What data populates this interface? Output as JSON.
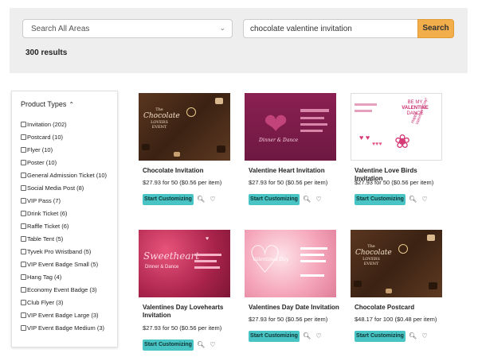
{
  "search": {
    "area_placeholder": "Search All Areas",
    "query": "chocolate valentine invitation",
    "button_label": "Search",
    "results": "300 results"
  },
  "filters": {
    "heading": "Product Types",
    "items": [
      {
        "label": "Invitation (202)"
      },
      {
        "label": "Postcard (10)"
      },
      {
        "label": "Flyer (10)"
      },
      {
        "label": "Poster (10)"
      },
      {
        "label": "General Admission Ticket (10)"
      },
      {
        "label": "Social Media Post (8)"
      },
      {
        "label": "VIP Pass (7)"
      },
      {
        "label": "Drink Ticket (6)"
      },
      {
        "label": "Raffle Ticket (6)"
      },
      {
        "label": "Table Tent (5)"
      },
      {
        "label": "Tyvek Pro Wristband (5)"
      },
      {
        "label": "VIP Event Badge Small (5)"
      },
      {
        "label": "Hang Tag (4)"
      },
      {
        "label": "Economy Event Badge (3)"
      },
      {
        "label": "Club Flyer (3)"
      },
      {
        "label": "VIP Event Badge Large (3)"
      },
      {
        "label": "VIP Event Badge Medium (3)"
      }
    ]
  },
  "products": [
    {
      "title": "Chocolate Invitation",
      "price": "$27.93 for 50 ($0.56 per item)",
      "cta": "Start Customizing",
      "thumb_art": {
        "l1": "The",
        "l2": "Chocolate",
        "l3": "LOVERS EVENT"
      }
    },
    {
      "title": "Valentine Heart Invitation",
      "price": "$27.93 for 50 ($0.56 per item)",
      "cta": "Start Customizing",
      "thumb_art": {
        "l1": "Dinner & Dance"
      }
    },
    {
      "title": "Valentine Love Birds Invitation",
      "price": "$27.93 for 50 ($0.56 per item)",
      "cta": "Start Customizing",
      "thumb_art": {
        "l1": "BE MY",
        "l2": "VALENTINE",
        "l3": "DANCE",
        "l4": "Happy Valentine's Day!"
      }
    },
    {
      "title": "Valentines Day Lovehearts Invitation",
      "price": "$27.93 for 50 ($0.56 per item)",
      "cta": "Start Customizing",
      "thumb_art": {
        "l1": "Sweetheart",
        "l2": "Dinner & Dance"
      }
    },
    {
      "title": "Valentines Day Date Invitation",
      "price": "$27.93 for 50 ($0.56 per item)",
      "cta": "Start Customizing",
      "thumb_art": {
        "l1": "Valentines Day"
      }
    },
    {
      "title": "Chocolate Postcard",
      "price": "$48.17 for 100 ($0.48 per item)",
      "cta": "Start Customizing",
      "thumb_art": {
        "l1": "The",
        "l2": "Chocolate",
        "l3": "LOVERS EVENT"
      }
    }
  ],
  "colors": {
    "accent": "#48c4c4",
    "search_button": "#f2ae4a"
  },
  "icons": {
    "zoom": "magnifier-icon",
    "favorite": "heart-icon",
    "collapse": "chevron-up-icon",
    "dropdown": "chevron-down-icon"
  }
}
